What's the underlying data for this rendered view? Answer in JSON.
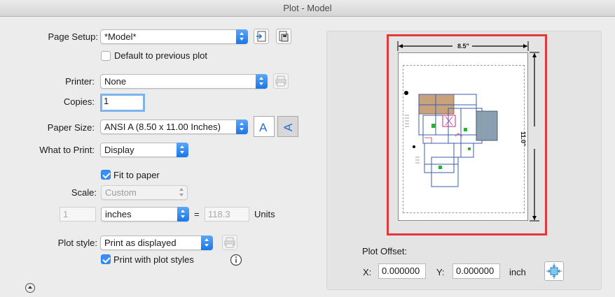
{
  "window": {
    "title": "Plot - Model"
  },
  "page_setup": {
    "label": "Page Setup:",
    "value": "*Model*",
    "default_previous_label": "Default to previous plot",
    "default_previous_checked": false
  },
  "printer": {
    "label": "Printer:",
    "value": "None"
  },
  "copies": {
    "label": "Copies:",
    "value": "1"
  },
  "paper_size": {
    "label": "Paper Size:",
    "value": "ANSI A (8.50 x 11.00 Inches)"
  },
  "what_to_print": {
    "label": "What to Print:",
    "value": "Display"
  },
  "fit_to_paper": {
    "label": "Fit to paper",
    "checked": true
  },
  "scale": {
    "label": "Scale:",
    "value": "Custom",
    "left_value": "1",
    "unit": "inches",
    "equals": "=",
    "right_value": "118.3",
    "units_label": "Units"
  },
  "plot_style": {
    "label": "Plot style:",
    "value": "Print as displayed",
    "print_with_styles_label": "Print with plot styles",
    "print_with_styles_checked": true
  },
  "preview": {
    "width_label": "8.5\"",
    "height_label": "11.0\""
  },
  "plot_offset": {
    "title": "Plot Offset:",
    "x_label": "X:",
    "x_value": "0.000000",
    "y_label": "Y:",
    "y_value": "0.000000",
    "unit": "inch"
  },
  "colors": {
    "accent": "#3a8ef5",
    "highlight": "#e03a3a"
  }
}
